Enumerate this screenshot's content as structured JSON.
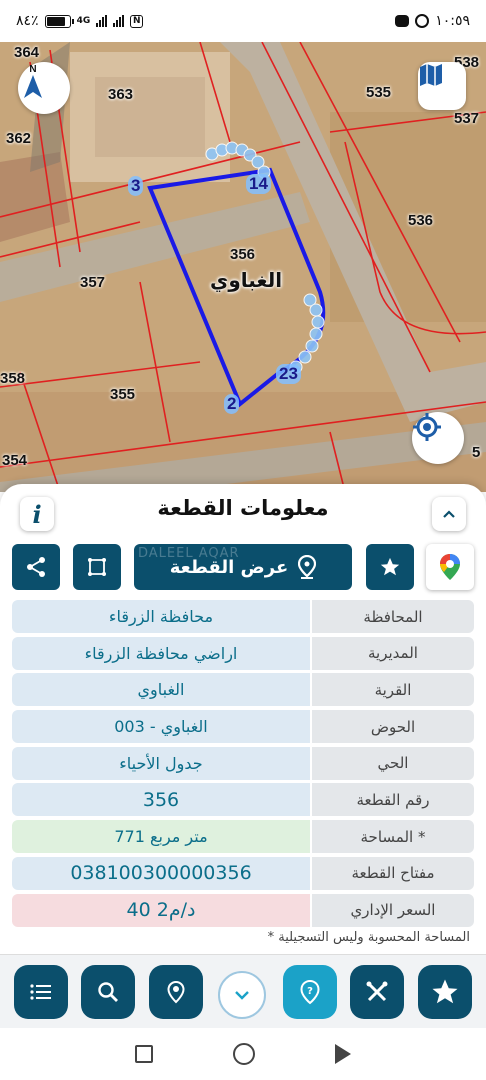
{
  "status_bar": {
    "time": "١٠:٥٩",
    "battery": "٨٤٪",
    "battery_level": 0.84,
    "network": "4G"
  },
  "map": {
    "compass_label": "N",
    "village_label": "الغباوي",
    "parcel_numbers": [
      "364",
      "363",
      "362",
      "357",
      "356",
      "358",
      "355",
      "354",
      "535",
      "536",
      "537",
      "538",
      "5"
    ],
    "vertex_labels": [
      "3",
      "14",
      "2",
      "23"
    ],
    "boundary_color": "#1a1ae6",
    "parcel_line_color": "#e02020"
  },
  "panel": {
    "title": "معلومات القطعة",
    "info_icon": "i",
    "watermark": "DALEEL AQAR",
    "show_plot_button": "عرض القطعة",
    "rows": [
      {
        "label": "المحافظة",
        "value": "محافظة الزرقاء"
      },
      {
        "label": "المديرية",
        "value": "اراضي محافظة الزرقاء"
      },
      {
        "label": "القرية",
        "value": "الغباوي"
      },
      {
        "label": "الحوض",
        "value": "الغباوي - 003"
      },
      {
        "label": "الحي",
        "value": "جدول الأحياء"
      },
      {
        "label": "رقم القطعة",
        "value": "356"
      },
      {
        "label": "المساحة *",
        "value": "771  متر مربع"
      },
      {
        "label": "مفتاح القطعة",
        "value": "038100300000356"
      },
      {
        "label": "السعر الإداري",
        "value": "40 د/م2"
      }
    ],
    "footnote": "* المساحة المحسوبة وليس التسجيلية"
  },
  "colors": {
    "primary": "#0b4f6c",
    "accent": "#1ba2c8",
    "value_bg": "#dde9f3",
    "area_bg": "#dff1de",
    "price_bg": "#f6dcdf"
  }
}
